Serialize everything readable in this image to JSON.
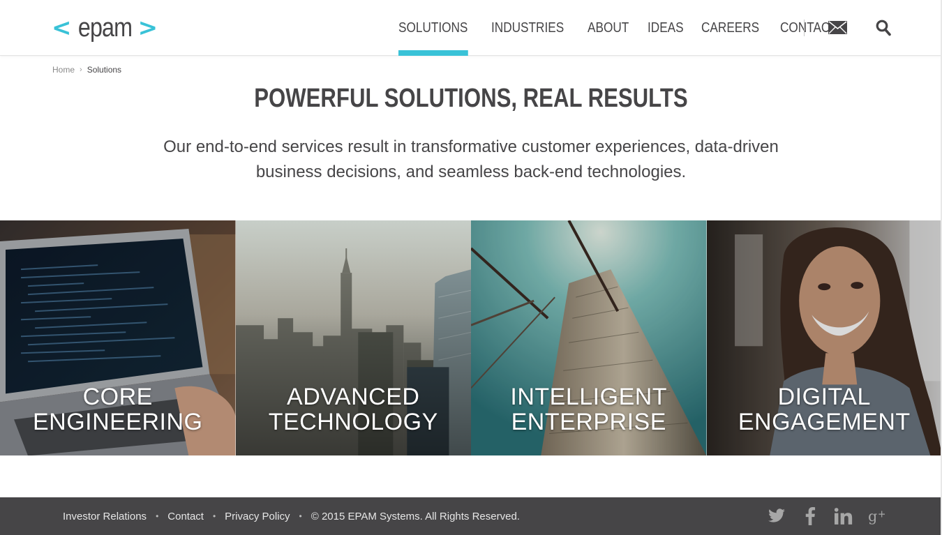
{
  "header": {
    "logo_text": "epam",
    "nav": [
      {
        "label": "SOLUTIONS",
        "active": true
      },
      {
        "label": "INDUSTRIES",
        "active": false
      },
      {
        "label": "ABOUT",
        "active": false
      },
      {
        "label": "IDEAS",
        "active": false
      },
      {
        "label": "CAREERS",
        "active": false
      },
      {
        "label": "CONTACT",
        "active": false
      }
    ],
    "icons": [
      "mail-icon",
      "search-icon"
    ]
  },
  "breadcrumb": {
    "home": "Home",
    "current": "Solutions"
  },
  "hero": {
    "title": "POWERFUL SOLUTIONS, REAL RESULTS",
    "intro": "Our end-to-end services result in transformative customer experiences, data-driven business decisions, and seamless back-end technologies."
  },
  "tiles": [
    {
      "line1": "CORE",
      "line2": "ENGINEERING"
    },
    {
      "line1": "ADVANCED",
      "line2": "TECHNOLOGY"
    },
    {
      "line1": "INTELLIGENT",
      "line2": "ENTERPRISE"
    },
    {
      "line1": "DIGITAL",
      "line2": "ENGAGEMENT"
    }
  ],
  "footer": {
    "links": [
      "Investor Relations",
      "Contact",
      "Privacy Policy"
    ],
    "copyright": "© 2015 EPAM Systems. All Rights Reserved.",
    "social": [
      "twitter-icon",
      "facebook-icon",
      "linkedin-icon",
      "google-plus-icon"
    ]
  },
  "colors": {
    "accent": "#39c2d7",
    "text_dark": "#464547",
    "footer_bg": "#464547"
  }
}
